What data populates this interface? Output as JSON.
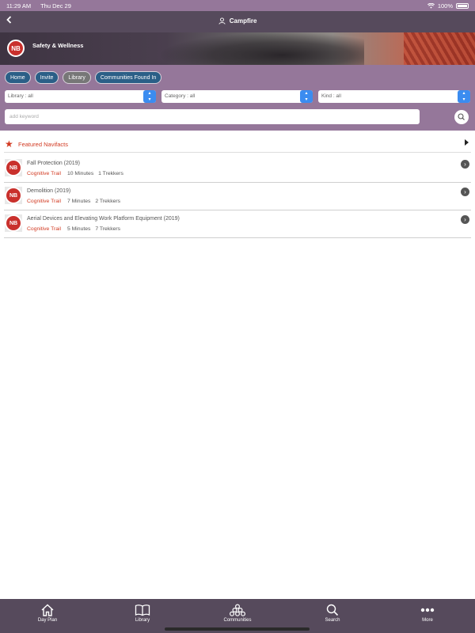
{
  "status_bar": {
    "time": "11:29 AM",
    "date": "Thu Dec 29",
    "battery": "100%"
  },
  "nav": {
    "title": "Campfire"
  },
  "banner": {
    "title": "Safety & Wellness"
  },
  "pills": [
    "Home",
    "Invite",
    "Library",
    "Communities Found In"
  ],
  "filters": {
    "library": "Library : all",
    "category": "Category : all",
    "kind": "Kind : all"
  },
  "search": {
    "placeholder": "add keyword"
  },
  "featured": {
    "label": "Featured Navifacts"
  },
  "items": [
    {
      "title": "Fall Protection (2019)",
      "kind": "Cognitive Trail",
      "duration": "10 Minutes",
      "trekkers": "1 Trekkers"
    },
    {
      "title": "Demolition (2019)",
      "kind": "Cognitive Trail",
      "duration": "7 Minutes",
      "trekkers": "2 Trekkers"
    },
    {
      "title": "Aerial Devices and Elevating Work Platform Equipment (2019)",
      "kind": "Cognitive Trail",
      "duration": "5 Minutes",
      "trekkers": "7 Trekkers"
    }
  ],
  "tabs": {
    "day_plan": "Day Plan",
    "library": "Library",
    "communities": "Communities",
    "search": "Search",
    "more": "More"
  },
  "colors": {
    "purple": "#95779a",
    "dark_purple": "#564a5c",
    "pill_blue": "#2b5f87",
    "accent_red": "#d23a22",
    "select_blue": "#3b8cf0"
  }
}
